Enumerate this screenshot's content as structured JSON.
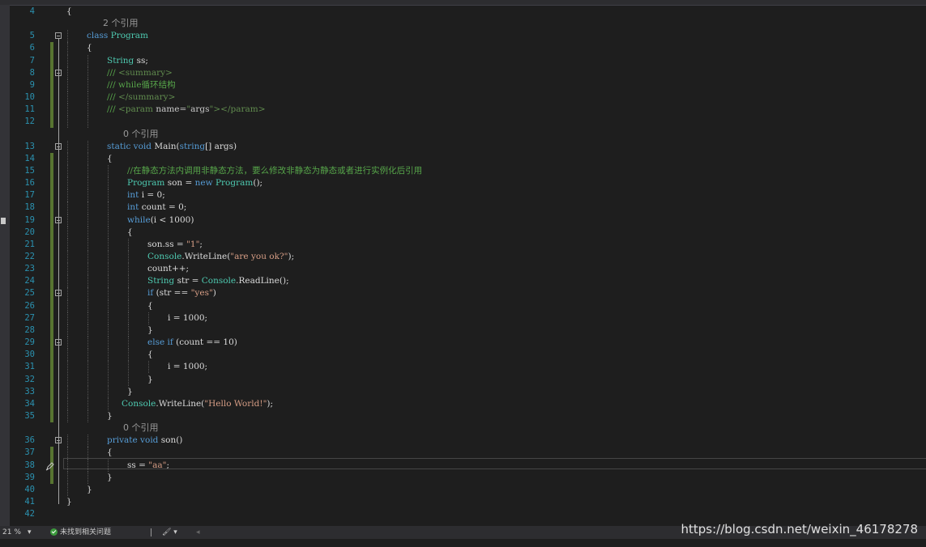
{
  "editor": {
    "lines": [
      {
        "n": "4",
        "tokens": [
          [
            "p",
            "{"
          ]
        ],
        "indent": 0
      },
      {
        "lens": "2 个引用"
      },
      {
        "n": "5",
        "tokens": [
          [
            "kw",
            "class "
          ],
          [
            "ty",
            "Program"
          ]
        ],
        "indent": 1
      },
      {
        "n": "6",
        "tokens": [
          [
            "p",
            "{"
          ]
        ],
        "indent": 1
      },
      {
        "n": "7",
        "tokens": [
          [
            "ty",
            "String "
          ],
          [
            "p",
            "ss;"
          ]
        ],
        "indent": 2
      },
      {
        "n": "8",
        "tokens": [
          [
            "xml",
            "/// "
          ],
          [
            "xmltag",
            "<summary>"
          ]
        ],
        "indent": 2
      },
      {
        "n": "9",
        "tokens": [
          [
            "xml",
            "/// while循环结构"
          ]
        ],
        "indent": 2
      },
      {
        "n": "10",
        "tokens": [
          [
            "xml",
            "/// "
          ],
          [
            "xmltag",
            "</summary>"
          ]
        ],
        "indent": 2
      },
      {
        "n": "11",
        "tokens": [
          [
            "xml",
            "/// "
          ],
          [
            "xmltag",
            "<param "
          ],
          [
            "xmlattr",
            "name="
          ],
          [
            "xmltag",
            "\""
          ],
          [
            "xmlattr",
            "args"
          ],
          [
            "xmltag",
            "\"></param>"
          ]
        ],
        "indent": 2
      },
      {
        "n": "12",
        "tokens": [],
        "indent": 2
      },
      {
        "lens": "0 个引用"
      },
      {
        "n": "13",
        "tokens": [
          [
            "kw",
            "static void "
          ],
          [
            "p",
            "Main("
          ],
          [
            "kw",
            "string"
          ],
          [
            "p",
            "[] args)"
          ]
        ],
        "indent": 2
      },
      {
        "n": "14",
        "tokens": [
          [
            "p",
            "{"
          ]
        ],
        "indent": 2
      },
      {
        "n": "15",
        "tokens": [
          [
            "cm",
            "//在静态方法内调用非静态方法，要么修改非静态为静态或者进行实例化后引用"
          ]
        ],
        "indent": 3
      },
      {
        "n": "16",
        "tokens": [
          [
            "ty",
            "Program "
          ],
          [
            "p",
            "son = "
          ],
          [
            "kw",
            "new "
          ],
          [
            "ty",
            "Program"
          ],
          [
            "p",
            "();"
          ]
        ],
        "indent": 3
      },
      {
        "n": "17",
        "tokens": [
          [
            "kw",
            "int "
          ],
          [
            "p",
            "i = 0;"
          ]
        ],
        "indent": 3
      },
      {
        "n": "18",
        "tokens": [
          [
            "kw",
            "int "
          ],
          [
            "p",
            "count = 0;"
          ]
        ],
        "indent": 3
      },
      {
        "n": "19",
        "tokens": [
          [
            "kw",
            "while"
          ],
          [
            "p",
            "(i < 1000)"
          ]
        ],
        "indent": 3
      },
      {
        "n": "20",
        "tokens": [
          [
            "p",
            "{"
          ]
        ],
        "indent": 3
      },
      {
        "n": "21",
        "tokens": [
          [
            "p",
            "son.ss = "
          ],
          [
            "st",
            "\"1\""
          ],
          [
            "p",
            ";"
          ]
        ],
        "indent": 4
      },
      {
        "n": "22",
        "tokens": [
          [
            "ty",
            "Console"
          ],
          [
            "p",
            "."
          ],
          [
            "p",
            "WriteLine("
          ],
          [
            "st",
            "\"are you ok?\""
          ],
          [
            "p",
            ");"
          ]
        ],
        "indent": 4
      },
      {
        "n": "23",
        "tokens": [
          [
            "p",
            "count++;"
          ]
        ],
        "indent": 4
      },
      {
        "n": "24",
        "tokens": [
          [
            "ty",
            "String "
          ],
          [
            "p",
            "str = "
          ],
          [
            "ty",
            "Console"
          ],
          [
            "p",
            ".ReadLine();"
          ]
        ],
        "indent": 4
      },
      {
        "n": "25",
        "tokens": [
          [
            "kw",
            "if "
          ],
          [
            "p",
            "(str == "
          ],
          [
            "st",
            "\"yes\""
          ],
          [
            "p",
            ")"
          ]
        ],
        "indent": 4
      },
      {
        "n": "26",
        "tokens": [
          [
            "p",
            "{"
          ]
        ],
        "indent": 4
      },
      {
        "n": "27",
        "tokens": [
          [
            "p",
            "i = 1000;"
          ]
        ],
        "indent": 5
      },
      {
        "n": "28",
        "tokens": [
          [
            "p",
            "}"
          ]
        ],
        "indent": 4
      },
      {
        "n": "29",
        "tokens": [
          [
            "kw",
            "else if "
          ],
          [
            "p",
            "(count == 10)"
          ]
        ],
        "indent": 4
      },
      {
        "n": "30",
        "tokens": [
          [
            "p",
            "{"
          ]
        ],
        "indent": 4
      },
      {
        "n": "31",
        "tokens": [
          [
            "p",
            "i = 1000;"
          ]
        ],
        "indent": 5
      },
      {
        "n": "32",
        "tokens": [
          [
            "p",
            "}"
          ]
        ],
        "indent": 4
      },
      {
        "n": "33",
        "tokens": [
          [
            "p",
            "}"
          ]
        ],
        "indent": 3
      },
      {
        "n": "34",
        "tokens": [
          [
            "ty",
            "Console"
          ],
          [
            "p",
            ".WriteLine("
          ],
          [
            "st",
            "\"Hello World!\""
          ],
          [
            "p",
            ");"
          ]
        ],
        "indent": 3,
        "shift": -7
      },
      {
        "n": "35",
        "tokens": [
          [
            "p",
            "}"
          ]
        ],
        "indent": 2
      },
      {
        "lens": "0 个引用"
      },
      {
        "n": "36",
        "tokens": [
          [
            "kw",
            "private void "
          ],
          [
            "p",
            "son()"
          ]
        ],
        "indent": 2
      },
      {
        "n": "37",
        "tokens": [
          [
            "p",
            "{"
          ]
        ],
        "indent": 2
      },
      {
        "n": "38",
        "tokens": [
          [
            "p",
            "ss = "
          ],
          [
            "st",
            "\"aa\""
          ],
          [
            "p",
            ";"
          ]
        ],
        "indent": 3
      },
      {
        "n": "39",
        "tokens": [
          [
            "p",
            "}"
          ]
        ],
        "indent": 2
      },
      {
        "n": "40",
        "tokens": [
          [
            "p",
            "}"
          ]
        ],
        "indent": 1
      },
      {
        "n": "41",
        "tokens": [
          [
            "p",
            "}"
          ]
        ],
        "indent": 0
      },
      {
        "n": "42",
        "tokens": [],
        "indent": 0
      }
    ]
  },
  "status": {
    "zoom": "21 %",
    "zoom_arrow": "▾",
    "issues": "未找到相关问题",
    "brush": "🖌 ▾",
    "nav_left": "◂"
  },
  "watermark": "https://blog.csdn.net/weixin_46178278",
  "colors": {
    "background": "#1e1e1e",
    "line_number": "#2b91af",
    "keyword": "#569cd6",
    "type": "#4ec9b0",
    "comment": "#57a64a",
    "string": "#d69d85",
    "change_bar": "#577430"
  }
}
